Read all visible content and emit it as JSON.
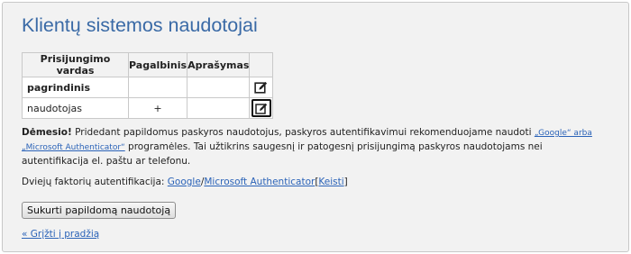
{
  "page": {
    "title": "Klientų sistemos naudotojai"
  },
  "table": {
    "headers": [
      "Prisijungimo vardas",
      "Pagalbinis",
      "Aprašymas",
      ""
    ],
    "rows": [
      {
        "username": "pagrindinis",
        "auxiliary": "",
        "description": "",
        "edit_icon": "edit-icon",
        "bold": true
      },
      {
        "username": "naudotojas",
        "auxiliary": "+",
        "description": "",
        "edit_icon": "edit-icon",
        "selected": true
      }
    ]
  },
  "notice": {
    "label": "Dėmesio!",
    "text_before": " Pridedant papildomus paskyros naudotojus, paskyros autentifikavimui rekomenduojame naudoti ",
    "link_google": "„Google“ arba",
    "text_middle": " ",
    "link_microsoft": "„Microsoft Authenticator“",
    "text_after": " programėles. Tai užtikrins saugesnį ir patogesnį prisijungimą paskyros naudotojams nei autentifikacija el. paštu ar telefonu."
  },
  "twofa": {
    "label": "Dviejų faktorių autentifikacija: ",
    "google": "Google",
    "separator": "/",
    "microsoft": "Microsoft Authenticator",
    "bracket_open": "[",
    "change": "Keisti",
    "bracket_close": "]"
  },
  "actions": {
    "create_label": "Sukurti papildomą naudotoją",
    "back_label": "« Grįžti į pradžią"
  },
  "colors": {
    "title": "#3a6aa6",
    "link": "#2b63b8",
    "panel_bg": "#f2f2f2"
  }
}
